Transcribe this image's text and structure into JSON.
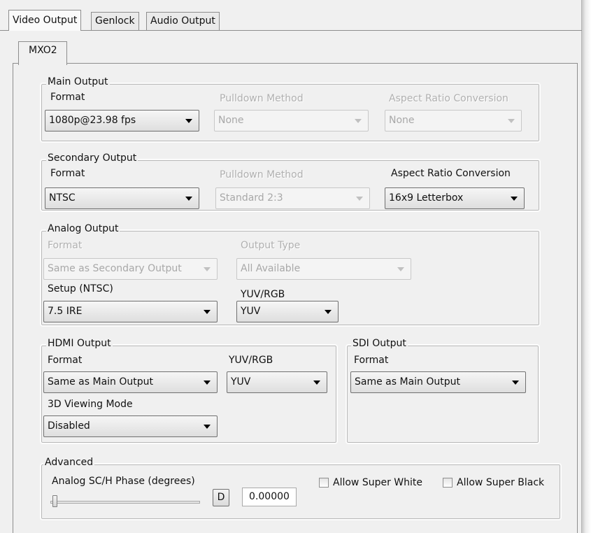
{
  "tabs": {
    "video_output": "Video Output",
    "genlock": "Genlock",
    "audio_output": "Audio Output"
  },
  "device_tab": "MXO2",
  "main_output": {
    "legend": "Main Output",
    "format_label": "Format",
    "format_value": "1080p@23.98 fps",
    "pulldown_label": "Pulldown Method",
    "pulldown_value": "None",
    "aspect_label": "Aspect Ratio Conversion",
    "aspect_value": "None"
  },
  "secondary_output": {
    "legend": "Secondary Output",
    "format_label": "Format",
    "format_value": "NTSC",
    "pulldown_label": "Pulldown Method",
    "pulldown_value": "Standard 2:3",
    "aspect_label": "Aspect Ratio Conversion",
    "aspect_value": "16x9 Letterbox"
  },
  "analog_output": {
    "legend": "Analog Output",
    "format_label": "Format",
    "format_value": "Same as Secondary Output",
    "output_type_label": "Output Type",
    "output_type_value": "All Available",
    "setup_label": "Setup (NTSC)",
    "setup_value": "7.5 IRE",
    "yuvrgb_label": "YUV/RGB",
    "yuvrgb_value": "YUV"
  },
  "hdmi_output": {
    "legend": "HDMI Output",
    "format_label": "Format",
    "format_value": "Same as Main Output",
    "yuvrgb_label": "YUV/RGB",
    "yuvrgb_value": "YUV",
    "viewing_label": "3D Viewing Mode",
    "viewing_value": "Disabled"
  },
  "sdi_output": {
    "legend": "SDI Output",
    "format_label": "Format",
    "format_value": "Same as Main Output"
  },
  "advanced": {
    "legend": "Advanced",
    "phase_label": "Analog SC/H Phase (degrees)",
    "default_button": "D",
    "phase_value": "0.00000",
    "slider_level": 0,
    "allow_super_white": "Allow Super White",
    "allow_super_black": "Allow Super Black",
    "super_white_checked": false,
    "super_black_checked": false
  },
  "colors": {
    "window_bg": "#f0f0f0",
    "disabled_text": "#b0b0b0",
    "group_border": "#b8b8b8"
  }
}
